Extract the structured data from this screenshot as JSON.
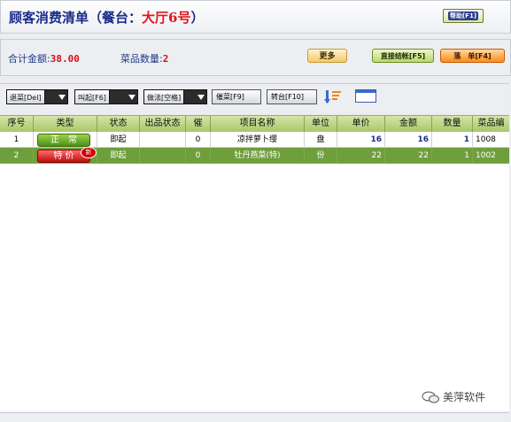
{
  "header": {
    "title_prefix": "顾客消费清单（餐台：",
    "table_name": "大厅6号",
    "title_suffix": "）",
    "help_button": "帮助[F1]"
  },
  "summary": {
    "total_label": "合计金额:",
    "total_value": "38.00",
    "count_label": "菜品数量:",
    "count_value": "2",
    "more_button": "更多",
    "settle_button": "直接结帐[F5]",
    "order_button": "落　单[F4]"
  },
  "toolbar": {
    "return_dish": "退菜[Del]",
    "call_dish": "叫起[F6]",
    "method": "做法[空格]",
    "rush_dish": "催菜[F9]",
    "transfer": "转台[F10]"
  },
  "table": {
    "columns": [
      "序号",
      "类型",
      "状态",
      "出品状态",
      "催",
      "项目名称",
      "单位",
      "单价",
      "金额",
      "数量",
      "菜品编"
    ],
    "rows": [
      {
        "no": "1",
        "type": "正　常",
        "type_style": "normal",
        "new_badge": "",
        "status": "即起",
        "out_status": "",
        "rush": "0",
        "name": "凉拌萝卜缨",
        "unit": "盘",
        "price": "16",
        "amount": "16",
        "qty": "1",
        "code": "1008",
        "selected": false
      },
      {
        "no": "2",
        "type": "特 价",
        "type_style": "special",
        "new_badge": "新",
        "status": "即起",
        "out_status": "",
        "rush": "0",
        "name": "牡丹燕菜(特)",
        "unit": "份",
        "price": "22",
        "amount": "22",
        "qty": "1",
        "code": "1002",
        "selected": true
      }
    ]
  },
  "watermark": "美萍软件",
  "colors": {
    "title_blue": "#1b2c8a",
    "accent_red": "#d0121a",
    "header_green": "#a8c76a",
    "selected_row": "#6f9e3c"
  },
  "icons": [
    "sort-icon",
    "window-icon",
    "wechat-icon"
  ]
}
